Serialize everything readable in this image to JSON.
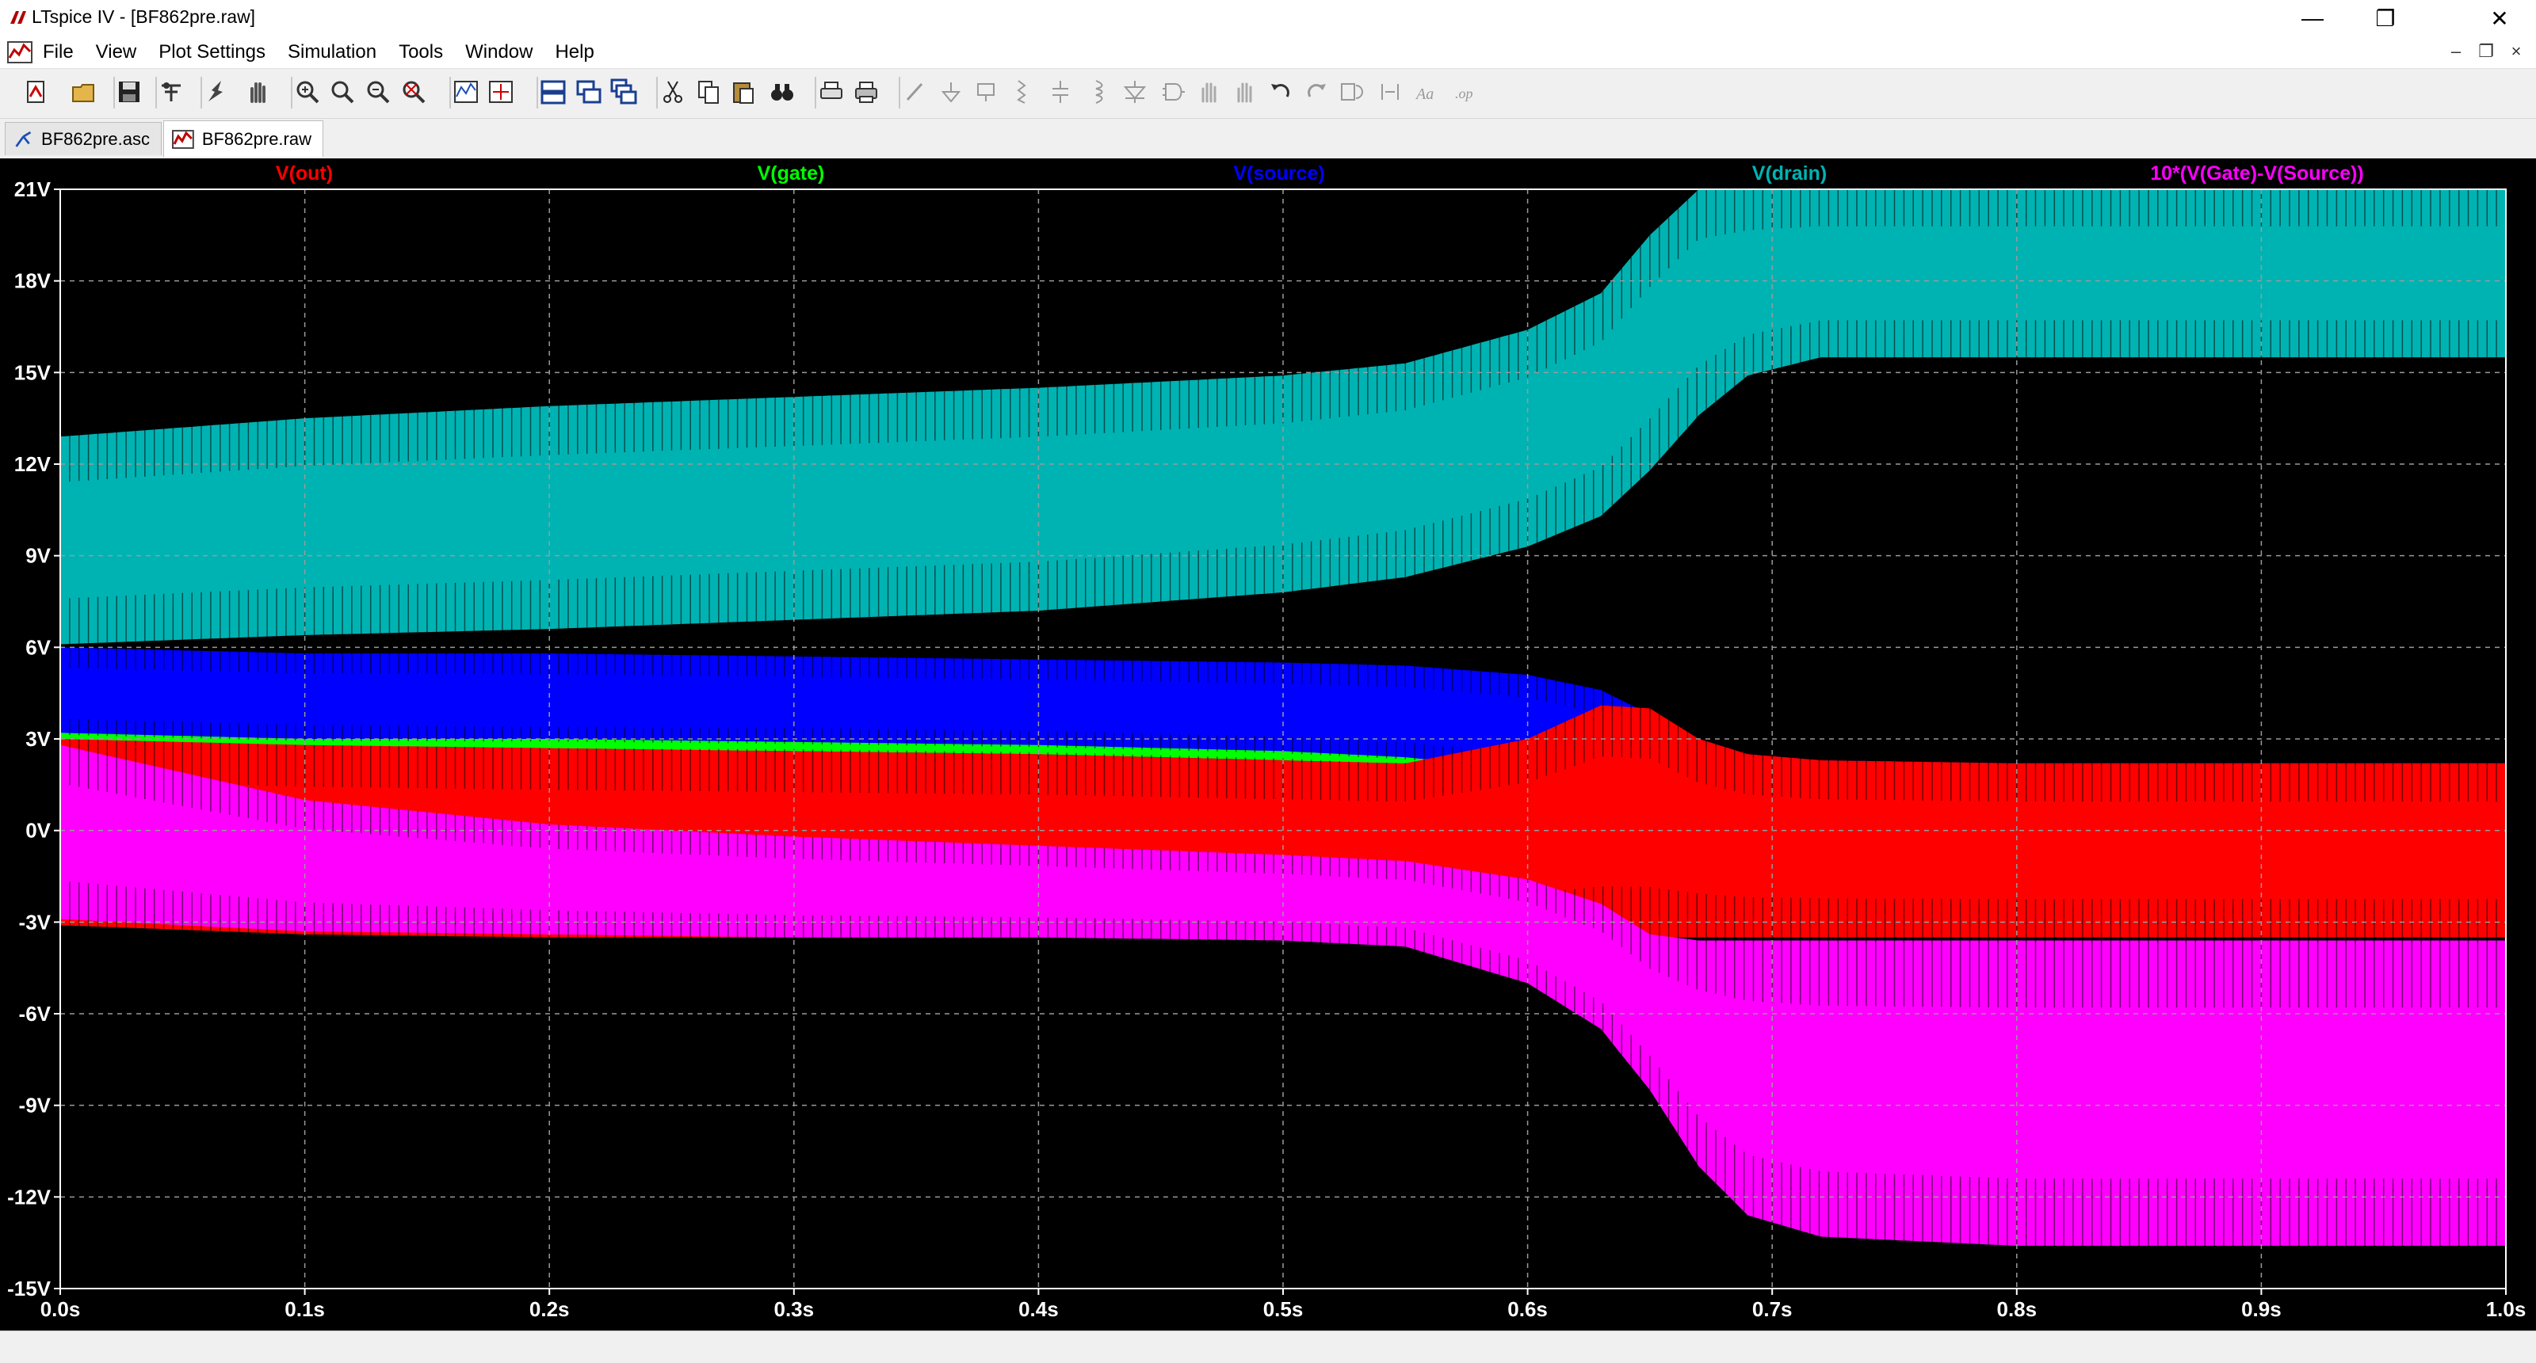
{
  "window": {
    "title": "LTspice IV - [BF862pre.raw]",
    "minimize_glyph": "—",
    "restore_glyph": "❐",
    "close_glyph": "✕"
  },
  "menu": {
    "items": [
      "File",
      "View",
      "Plot Settings",
      "Simulation",
      "Tools",
      "Window",
      "Help"
    ],
    "mdi_minimize": "–",
    "mdi_restore": "❐",
    "mdi_close": "×"
  },
  "toolbar": {
    "buttons": [
      "new-schematic-icon",
      "open-icon",
      "save-icon",
      "control-panel-icon",
      "run-icon",
      "pan-icon",
      "zoom-in-icon",
      "zoom-full-icon",
      "zoom-out-icon",
      "zoom-cancel-icon",
      "autorange-icon",
      "mark-unconnected-icon",
      "tile-horizontal-icon",
      "tile-vertical-icon",
      "cascade-icon",
      "cut-icon",
      "copy-icon",
      "paste-icon",
      "find-icon",
      "print-preview-icon",
      "print-icon",
      "wire-icon",
      "ground-icon",
      "label-net-icon",
      "resistor-icon",
      "capacitor-icon",
      "inductor-icon",
      "diode-icon",
      "component-icon",
      "move-icon",
      "drag-icon",
      "undo-icon",
      "redo-icon",
      "rotate-icon",
      "mirror-icon",
      "text-icon",
      "spice-directive-icon"
    ]
  },
  "tabs": [
    {
      "label": "BF862pre.asc",
      "icon": "schematic-icon",
      "active": false
    },
    {
      "label": "BF862pre.raw",
      "icon": "waveform-icon",
      "active": true
    }
  ],
  "colors": {
    "v_out": "#ff0000",
    "v_gate": "#00ff00",
    "v_source": "#0000ff",
    "v_drain": "#00b3b3",
    "vgs_x10": "#ff00ff",
    "plot_bg": "#000000",
    "axis_text": "#ffffff"
  },
  "chart_data": {
    "type": "area",
    "xlabel": "",
    "ylabel": "",
    "xlim": [
      0.0,
      1.0
    ],
    "ylim": [
      -15,
      21
    ],
    "x_ticks": [
      "0.0s",
      "0.1s",
      "0.2s",
      "0.3s",
      "0.4s",
      "0.5s",
      "0.6s",
      "0.7s",
      "0.8s",
      "0.9s",
      "1.0s"
    ],
    "y_ticks": [
      "21V",
      "18V",
      "15V",
      "12V",
      "9V",
      "6V",
      "3V",
      "0V",
      "-3V",
      "-6V",
      "-9V",
      "-12V",
      "-15V"
    ],
    "grid": true,
    "legend_placement": "top",
    "x": [
      0.0,
      0.1,
      0.2,
      0.3,
      0.4,
      0.5,
      0.55,
      0.6,
      0.63,
      0.65,
      0.67,
      0.69,
      0.72,
      0.8,
      0.9,
      1.0
    ],
    "series": [
      {
        "name": "V(drain)",
        "color_key": "v_drain",
        "upper": [
          12.9,
          13.5,
          13.9,
          14.2,
          14.5,
          14.9,
          15.3,
          16.4,
          17.6,
          19.5,
          21.0,
          21.0,
          21.0,
          21.0,
          21.0,
          21.0
        ],
        "lower": [
          6.1,
          6.4,
          6.6,
          6.9,
          7.2,
          7.8,
          8.3,
          9.3,
          10.3,
          11.8,
          13.6,
          14.9,
          15.5,
          15.5,
          15.5,
          15.5
        ]
      },
      {
        "name": "V(source)",
        "color_key": "v_source",
        "upper": [
          6.0,
          5.8,
          5.8,
          5.7,
          5.6,
          5.5,
          5.4,
          5.1,
          4.6,
          3.8,
          3.0,
          2.5,
          2.3,
          2.2,
          2.2,
          2.2
        ],
        "lower": [
          3.0,
          2.8,
          2.7,
          2.7,
          2.6,
          2.4,
          2.2,
          1.7,
          1.0,
          0.2,
          -0.1,
          0.0,
          0.0,
          0.0,
          0.0,
          0.0
        ]
      },
      {
        "name": "V(gate)",
        "color_key": "v_gate",
        "upper": [
          3.2,
          3.0,
          3.0,
          2.9,
          2.8,
          2.6,
          2.4,
          2.0,
          1.3,
          0.5,
          0.0,
          0.0,
          0.0,
          0.0,
          0.0,
          0.0
        ],
        "lower": [
          2.9,
          2.7,
          2.6,
          2.6,
          2.5,
          2.3,
          2.1,
          1.6,
          0.9,
          0.0,
          -0.8,
          -1.2,
          -1.3,
          -1.3,
          -1.3,
          -1.3
        ]
      },
      {
        "name": "V(out)",
        "color_key": "v_out",
        "upper": [
          3.0,
          2.8,
          2.7,
          2.6,
          2.5,
          2.3,
          2.2,
          3.0,
          4.1,
          4.0,
          3.0,
          2.5,
          2.3,
          2.2,
          2.2,
          2.2
        ],
        "lower": [
          -3.1,
          -3.4,
          -3.5,
          -3.5,
          -3.5,
          -3.5,
          -3.5,
          -3.5,
          -3.5,
          -3.5,
          -3.5,
          -3.5,
          -3.5,
          -3.5,
          -3.5,
          -3.5
        ]
      },
      {
        "name": "10*(V(Gate)-V(Source))",
        "color_key": "vgs_x10",
        "upper": [
          2.8,
          1.0,
          0.2,
          -0.2,
          -0.5,
          -0.8,
          -1.0,
          -1.6,
          -2.4,
          -3.4,
          -3.6,
          -3.6,
          -3.6,
          -3.6,
          -3.6,
          -3.6
        ],
        "lower": [
          -2.9,
          -3.3,
          -3.4,
          -3.5,
          -3.5,
          -3.6,
          -3.8,
          -5.0,
          -6.5,
          -8.5,
          -11.0,
          -12.6,
          -13.3,
          -13.6,
          -13.6,
          -13.6
        ]
      }
    ],
    "legend": [
      {
        "name": "V(out)",
        "color_key": "v_out"
      },
      {
        "name": "V(gate)",
        "color_key": "v_gate"
      },
      {
        "name": "V(source)",
        "color_key": "v_source"
      },
      {
        "name": "V(drain)",
        "color_key": "v_drain"
      },
      {
        "name": "10*(V(Gate)-V(Source))",
        "color_key": "vgs_x10"
      }
    ]
  }
}
